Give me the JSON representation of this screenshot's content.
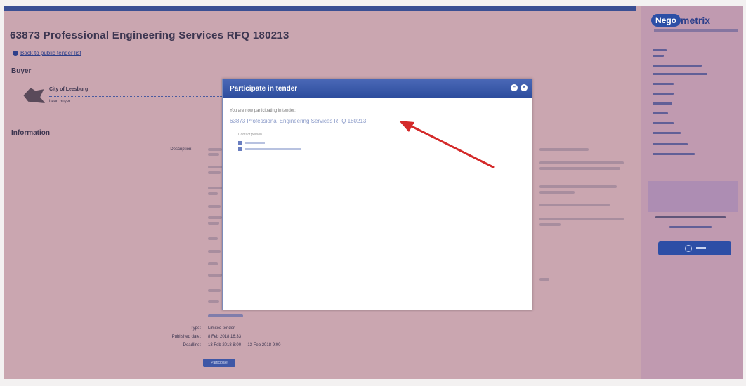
{
  "page": {
    "title": "63873 Professional Engineering Services RFQ 180213",
    "back_link": "Back to public tender list",
    "buyer_heading": "Buyer",
    "buyer_name": "City of Leesburg",
    "buyer_role": "Lead buyer",
    "info_heading": "Information",
    "field_labels": {
      "description": "Description:",
      "type": "Type:",
      "published": "Published date:",
      "deadline": "Deadline:"
    },
    "field_values": {
      "type": "Limited tender",
      "published": "8 Feb 2018 16:33",
      "deadline": "13 Feb 2018 8:00 — 13 Feb 2018 9:00"
    },
    "participate_button": "Participate"
  },
  "sidebar": {
    "logo_left": "Nego",
    "logo_right": "metrix"
  },
  "modal": {
    "title": "Participate in tender",
    "close_icon": "close-icon",
    "collapse_icon": "minimize-icon",
    "message": "You are now participating in tender:",
    "tender_link": "63873 Professional Engineering Services RFQ 180213",
    "contact_label": "Contact person"
  },
  "annotation": {
    "arrow_color": "#d42a2a"
  },
  "colors": {
    "page_tint": "#caa6b0",
    "header_blue": "#2d4d9e",
    "link_blue": "#2e3f8a"
  }
}
